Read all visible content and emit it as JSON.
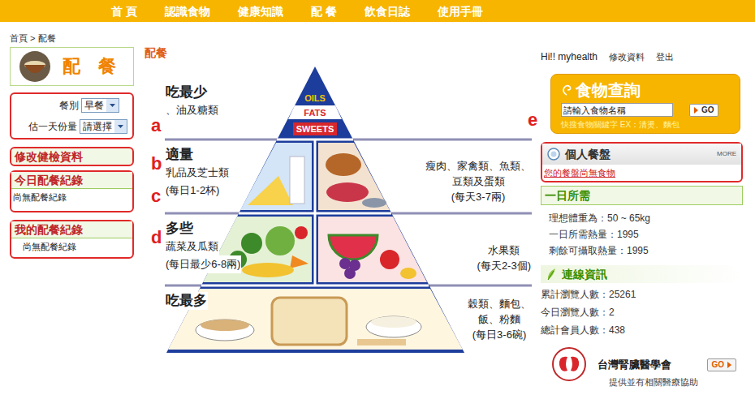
{
  "nav": [
    "首 頁",
    "認識食物",
    "健康知識",
    "配 餐",
    "飲食日誌",
    "使用手冊"
  ],
  "breadcrumb": "首頁 > 配餐",
  "left": {
    "logo": "配　餐",
    "meal_select": {
      "label": "餐別",
      "value": "早餐"
    },
    "portion_select": {
      "label": "估一天份量",
      "value": "請選擇"
    },
    "edit_health": "修改健檢資料",
    "sections": [
      {
        "title": "今日配餐紀錄",
        "empty": "尚無配餐紀錄"
      },
      {
        "title": "我的配餐紀錄",
        "empty": "尚無配餐紀錄"
      }
    ]
  },
  "main": {
    "title": "配餐",
    "pyramid": {
      "apex": [
        "OILS",
        "FATS",
        "SWEETS"
      ],
      "tiers": [
        {
          "title": "吃最少",
          "left": [
            "、油及糖類"
          ],
          "right": []
        },
        {
          "title": "適量",
          "left": [
            "乳品及芝士類",
            "(每日1-2杯)"
          ],
          "right": [
            "瘦肉、家禽類、魚類、",
            "豆類及蛋類",
            "(每天3-7兩)"
          ]
        },
        {
          "title": "多些",
          "left": [
            "蔬菜及瓜類",
            "(每日最少6-8兩)"
          ],
          "right": [
            "水果類",
            "(每天2-3個)"
          ]
        },
        {
          "title": "吃最多",
          "left": [],
          "right": [
            "穀類、麵包、",
            "飯、粉麵",
            "(每日3-6碗)"
          ]
        }
      ]
    }
  },
  "annotations": [
    "a",
    "b",
    "c",
    "d",
    "e"
  ],
  "right": {
    "user": {
      "greeting": "Hi!! myhealth",
      "links": [
        "修改資料",
        "登出"
      ]
    },
    "food_search": {
      "title": "食物查詢",
      "placeholder": "請輸入食物名稱",
      "button": "GO",
      "hint": "快搜食物關鍵字 EX：清燙、麵包"
    },
    "plate": {
      "title": "個人餐盤",
      "more": "MORE",
      "empty": "您的餐盤尚無食物"
    },
    "daily": {
      "title": "一日所需",
      "items": [
        "理想體重為：50 ~ 65kg",
        "一日所需熱量：1995",
        "剩餘可攝取熱量：1995"
      ]
    },
    "stats": {
      "title": "連線資訊",
      "items": [
        "累計瀏覽人數：25261",
        "今日瀏覽人數：2",
        "總計會員人數：438"
      ]
    },
    "partner": {
      "name": "台灣腎臟醫學會",
      "button": "GO",
      "tagline": "提供並有相關醫療協助"
    }
  }
}
